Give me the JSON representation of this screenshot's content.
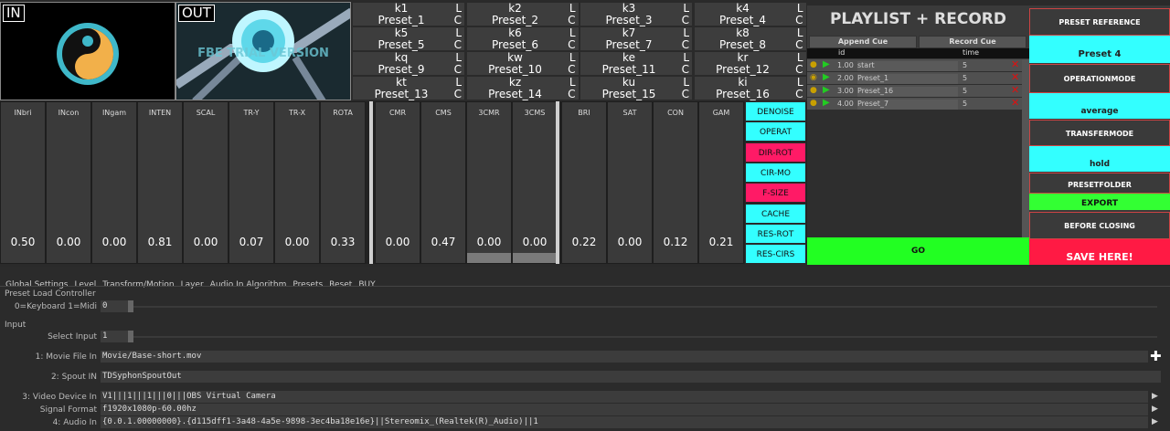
{
  "previews": {
    "in_label": "IN",
    "out_label": "OUT",
    "watermark": "FBE TRIAL VERSION"
  },
  "presets": [
    {
      "key": "k1",
      "name": "Preset_1"
    },
    {
      "key": "k2",
      "name": "Preset_2"
    },
    {
      "key": "k3",
      "name": "Preset_3"
    },
    {
      "key": "k4",
      "name": "Preset_4"
    },
    {
      "key": "k5",
      "name": "Preset_5"
    },
    {
      "key": "k6",
      "name": "Preset_6"
    },
    {
      "key": "k7",
      "name": "Preset_7"
    },
    {
      "key": "k8",
      "name": "Preset_8"
    },
    {
      "key": "kq",
      "name": "Preset_9"
    },
    {
      "key": "kw",
      "name": "Preset_10"
    },
    {
      "key": "ke",
      "name": "Preset_11"
    },
    {
      "key": "kr",
      "name": "Preset_12"
    },
    {
      "key": "kt",
      "name": "Preset_13"
    },
    {
      "key": "kz",
      "name": "Preset_14"
    },
    {
      "key": "ku",
      "name": "Preset_15"
    },
    {
      "key": "ki",
      "name": "Preset_16"
    }
  ],
  "preset_flags": {
    "l": "L",
    "c": "C"
  },
  "sliders": [
    {
      "label": "INbri",
      "value": "0.50"
    },
    {
      "label": "INcon",
      "value": "0.00"
    },
    {
      "label": "INgam",
      "value": "0.00"
    },
    {
      "label": "INTEN",
      "value": "0.81"
    },
    {
      "label": "SCAL",
      "value": "0.00"
    },
    {
      "label": "TR-Y",
      "value": "0.07"
    },
    {
      "label": "TR-X",
      "value": "0.00"
    },
    {
      "label": "ROTA",
      "value": "0.33"
    },
    {
      "label": "CMR",
      "value": "0.00"
    },
    {
      "label": "CMS",
      "value": "0.47"
    },
    {
      "label": "3CMR",
      "value": "0.00",
      "fill": 0.06
    },
    {
      "label": "3CMS",
      "value": "0.00",
      "fill": 0.06
    },
    {
      "label": "BRI",
      "value": "0.22"
    },
    {
      "label": "SAT",
      "value": "0.00"
    },
    {
      "label": "CON",
      "value": "0.12"
    },
    {
      "label": "GAM",
      "value": "0.21"
    }
  ],
  "toggles": [
    {
      "label": "DENOISE",
      "active": false
    },
    {
      "label": "OPERAT",
      "active": false
    },
    {
      "label": "DIR-ROT",
      "active": true
    },
    {
      "label": "CIR-MO",
      "active": false
    },
    {
      "label": "F-SIZE",
      "active": true
    },
    {
      "label": "CACHE",
      "active": false
    },
    {
      "label": "RES-ROT",
      "active": false
    },
    {
      "label": "RES-CIRS",
      "active": false
    }
  ],
  "playlist": {
    "title": "PLAYLIST + RECORD",
    "append_cue": "Append Cue",
    "record_cue": "Record Cue",
    "col_id": "id",
    "col_time": "time",
    "rows": [
      {
        "num": "1.00",
        "name": "start",
        "time": "5"
      },
      {
        "num": "2.00",
        "name": "Preset_1",
        "time": "5"
      },
      {
        "num": "3.00",
        "name": "Preset_16",
        "time": "5"
      },
      {
        "num": "4.00",
        "name": "Preset_7",
        "time": "5"
      }
    ],
    "go": "GO"
  },
  "right": {
    "preset_reference_label": "PRESET REFERENCE",
    "preset_reference_value": "Preset 4",
    "operationmode_label": "OPERATIONMODE",
    "operationmode_value": "average",
    "transfermode_label": "TRANSFERMODE",
    "transfermode_value": "hold",
    "presetfolder_label": "PRESETFOLDER",
    "export": "EXPORT",
    "before_closing": "BEFORE CLOSING",
    "save": "SAVE HERE!"
  },
  "tabs": [
    "Global Settings",
    "Level",
    "Transform/Motion",
    "Layer",
    "Audio In Algorithm",
    "Presets",
    "Reset",
    "BUY"
  ],
  "params": {
    "preset_load_controller": "Preset Load Controller",
    "keyboard_midi_label": "0=Keyboard 1=Midi",
    "keyboard_midi_value": "0",
    "input_section": "Input",
    "select_input_label": "Select Input",
    "select_input_value": "1",
    "movie_file_label": "1: Movie File In",
    "movie_file_value": "Movie/Base-short.mov",
    "spout_label": "2: Spout IN",
    "spout_value": "TDSyphonSpoutOut",
    "video_device_label": "3: Video Device In",
    "video_device_value": "V1|||1|||1|||0|||OBS Virtual Camera",
    "signal_format_label": "Signal Format",
    "signal_format_value": "f1920x1080p-60.00hz",
    "audio_in_label": "4: Audio In",
    "audio_in_value": "{0.0.1.00000000}.{d115dff1-3a48-4a5e-9898-3ec4ba18e16e}||Stereomix_(Realtek(R)_Audio)||1"
  },
  "colors": {
    "cyan": "#33ffff",
    "pink": "#ff1a66",
    "green": "#22ff22",
    "red": "#ff1a44"
  }
}
